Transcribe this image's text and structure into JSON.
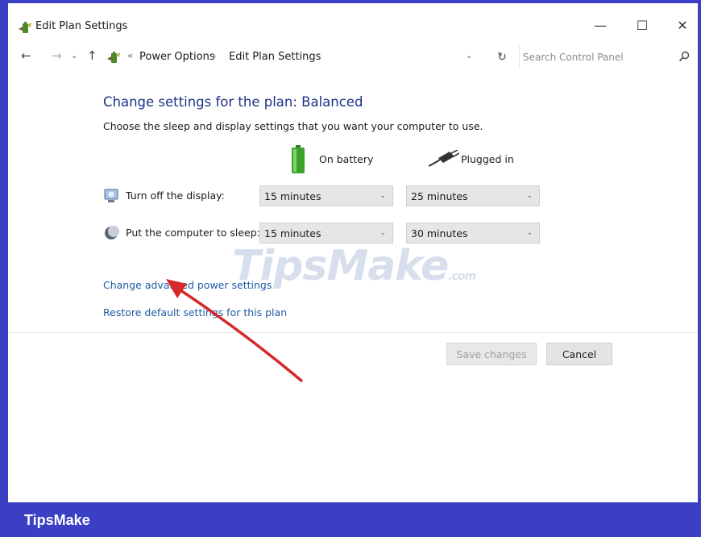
{
  "window": {
    "title": "Edit Plan Settings",
    "minimize_glyph": "—",
    "maximize_glyph": "☐",
    "close_glyph": "✕"
  },
  "nav": {
    "back": "←",
    "forward": "→",
    "recent": "⌄",
    "up": "↑",
    "separator": "«",
    "breadcrumb": [
      "Power Options",
      "Edit Plan Settings"
    ],
    "crumb_arrow": "›",
    "dropdown": "⌄",
    "refresh": "↻",
    "search_placeholder": "Search Control Panel"
  },
  "content": {
    "heading": "Change settings for the plan: Balanced",
    "subtext": "Choose the sleep and display settings that you want your computer to use.",
    "columns": {
      "battery": "On battery",
      "plugged": "Plugged in"
    },
    "settings": [
      {
        "label": "Turn off the display:",
        "battery": "15 minutes",
        "plugged": "25 minutes"
      },
      {
        "label": "Put the computer to sleep:",
        "battery": "15 minutes",
        "plugged": "30 minutes"
      }
    ],
    "links": {
      "advanced": "Change advanced power settings",
      "restore": "Restore default settings for this plan"
    },
    "buttons": {
      "save": "Save changes",
      "cancel": "Cancel"
    }
  },
  "watermark": {
    "main": "TipsMake",
    "suffix": ".com"
  },
  "footer": {
    "text": "TipsMake"
  },
  "colors": {
    "frame": "#3a3fc4",
    "heading": "#1e3287",
    "link": "#1f5aa6",
    "arrow": "#d42a2a"
  }
}
